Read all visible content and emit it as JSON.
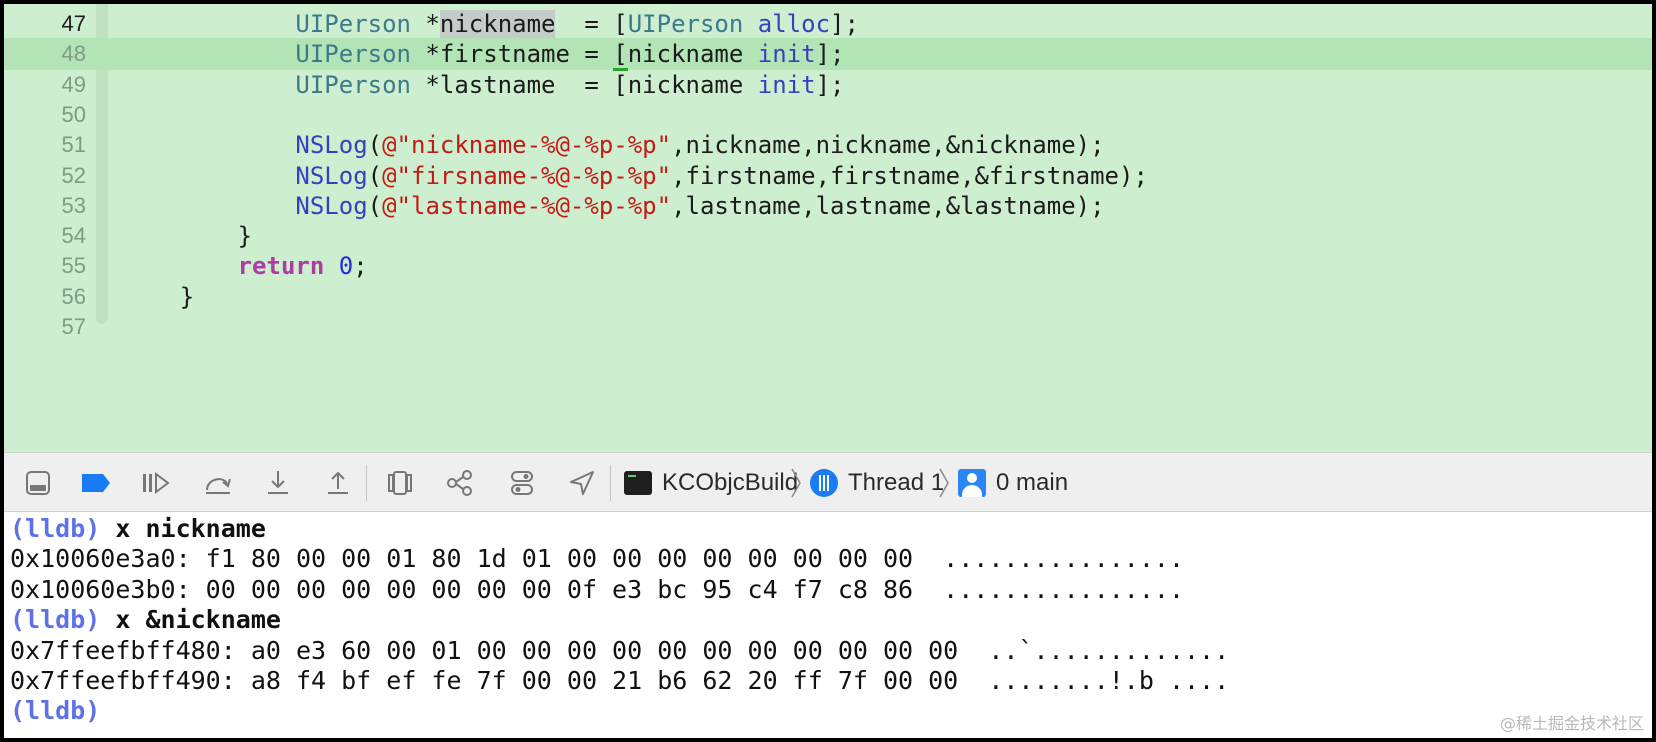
{
  "editor": {
    "lines": [
      {
        "num": "47",
        "current": true,
        "highlight": false,
        "tokens": [
          {
            "t": "            ",
            "c": ""
          },
          {
            "t": "UIPerson",
            "c": "t-type"
          },
          {
            "t": " *",
            "c": ""
          },
          {
            "t": "nickname",
            "c": "t-sel"
          },
          {
            "t": "  = [",
            "c": ""
          },
          {
            "t": "UIPerson",
            "c": "t-type"
          },
          {
            "t": " ",
            "c": ""
          },
          {
            "t": "alloc",
            "c": "t-func"
          },
          {
            "t": "];",
            "c": ""
          }
        ]
      },
      {
        "num": "48",
        "current": false,
        "highlight": true,
        "tokens": [
          {
            "t": "            ",
            "c": ""
          },
          {
            "t": "UIPerson",
            "c": "t-type"
          },
          {
            "t": " *firstname = ",
            "c": ""
          },
          {
            "t": "[",
            "c": "t-caret"
          },
          {
            "t": "nickname ",
            "c": ""
          },
          {
            "t": "init",
            "c": "t-func"
          },
          {
            "t": "];",
            "c": ""
          }
        ]
      },
      {
        "num": "49",
        "current": false,
        "highlight": false,
        "tokens": [
          {
            "t": "            ",
            "c": ""
          },
          {
            "t": "UIPerson",
            "c": "t-type"
          },
          {
            "t": " *lastname  = [nickname ",
            "c": ""
          },
          {
            "t": "init",
            "c": "t-func"
          },
          {
            "t": "];",
            "c": ""
          }
        ]
      },
      {
        "num": "50",
        "current": false,
        "highlight": false,
        "tokens": []
      },
      {
        "num": "51",
        "current": false,
        "highlight": false,
        "tokens": [
          {
            "t": "            ",
            "c": ""
          },
          {
            "t": "NSLog",
            "c": "t-func"
          },
          {
            "t": "(",
            "c": ""
          },
          {
            "t": "@\"nickname-%@-%p-%p\"",
            "c": "t-str"
          },
          {
            "t": ",nickname,nickname,&nickname);",
            "c": ""
          }
        ]
      },
      {
        "num": "52",
        "current": false,
        "highlight": false,
        "tokens": [
          {
            "t": "            ",
            "c": ""
          },
          {
            "t": "NSLog",
            "c": "t-func"
          },
          {
            "t": "(",
            "c": ""
          },
          {
            "t": "@\"firsname-%@-%p-%p\"",
            "c": "t-str"
          },
          {
            "t": ",firstname,firstname,&firstname);",
            "c": ""
          }
        ]
      },
      {
        "num": "53",
        "current": false,
        "highlight": false,
        "tokens": [
          {
            "t": "            ",
            "c": ""
          },
          {
            "t": "NSLog",
            "c": "t-func"
          },
          {
            "t": "(",
            "c": ""
          },
          {
            "t": "@\"lastname-%@-%p-%p\"",
            "c": "t-str"
          },
          {
            "t": ",lastname,lastname,&lastname);",
            "c": ""
          }
        ]
      },
      {
        "num": "54",
        "current": false,
        "highlight": false,
        "tokens": [
          {
            "t": "        }",
            "c": ""
          }
        ]
      },
      {
        "num": "55",
        "current": false,
        "highlight": false,
        "tokens": [
          {
            "t": "        ",
            "c": ""
          },
          {
            "t": "return",
            "c": "t-kw"
          },
          {
            "t": " ",
            "c": ""
          },
          {
            "t": "0",
            "c": "t-num"
          },
          {
            "t": ";",
            "c": ""
          }
        ]
      },
      {
        "num": "56",
        "current": false,
        "highlight": false,
        "tokens": [
          {
            "t": "    }",
            "c": ""
          }
        ]
      },
      {
        "num": "57",
        "current": false,
        "highlight": false,
        "tokens": []
      }
    ]
  },
  "toolbar": {
    "icons": [
      "hide-console-icon",
      "breakpoints-toggle-icon",
      "continue-icon",
      "step-over-icon",
      "step-into-icon",
      "step-out-icon",
      "debug-view-hierarchy-icon",
      "memory-graph-icon",
      "environment-overrides-icon",
      "simulate-location-icon"
    ],
    "breadcrumb": {
      "target": "KCObjcBuild",
      "thread": "Thread 1",
      "frame": "0 main"
    },
    "accent": "#1a7cf5"
  },
  "console": {
    "lines": [
      {
        "prompt": "(lldb)",
        "cmd": " x nickname",
        "text": ""
      },
      {
        "prompt": "",
        "cmd": "",
        "text": "0x10060e3a0: f1 80 00 00 01 80 1d 01 00 00 00 00 00 00 00 00  ................"
      },
      {
        "prompt": "",
        "cmd": "",
        "text": "0x10060e3b0: 00 00 00 00 00 00 00 00 0f e3 bc 95 c4 f7 c8 86  ................"
      },
      {
        "prompt": "(lldb)",
        "cmd": " x &nickname",
        "text": ""
      },
      {
        "prompt": "",
        "cmd": "",
        "text": "0x7ffeefbff480: a0 e3 60 00 01 00 00 00 00 00 00 00 00 00 00 00  ..`............."
      },
      {
        "prompt": "",
        "cmd": "",
        "text": "0x7ffeefbff490: a8 f4 bf ef fe 7f 00 00 21 b6 62 20 ff 7f 00 00  ........!.b ...."
      },
      {
        "prompt": "(lldb)",
        "cmd": "",
        "text": ""
      }
    ]
  },
  "watermark": "@稀土掘金技术社区"
}
